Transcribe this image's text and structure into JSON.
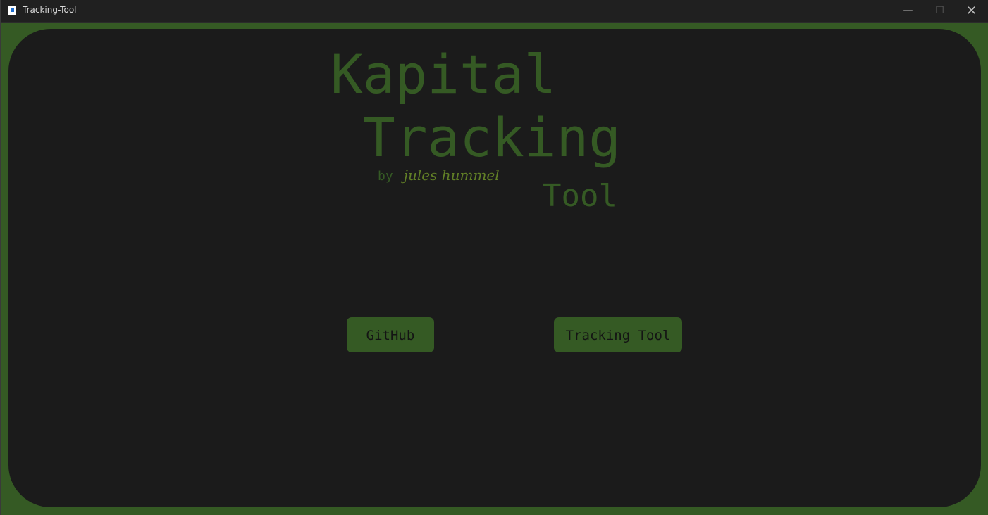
{
  "window": {
    "title": "Tracking-Tool",
    "controls": {
      "minimize": "—",
      "maximize": "☐",
      "close": "✕"
    }
  },
  "hero": {
    "line1": "Kapital",
    "line2": "Tracking",
    "line3": "Tool",
    "by_label": "by",
    "author": "jules hummel"
  },
  "buttons": {
    "github": "GitHub",
    "tracking_tool": "Tracking Tool"
  },
  "colors": {
    "accent": "#355a24",
    "background": "#1b1b1b",
    "author": "#617f26"
  }
}
